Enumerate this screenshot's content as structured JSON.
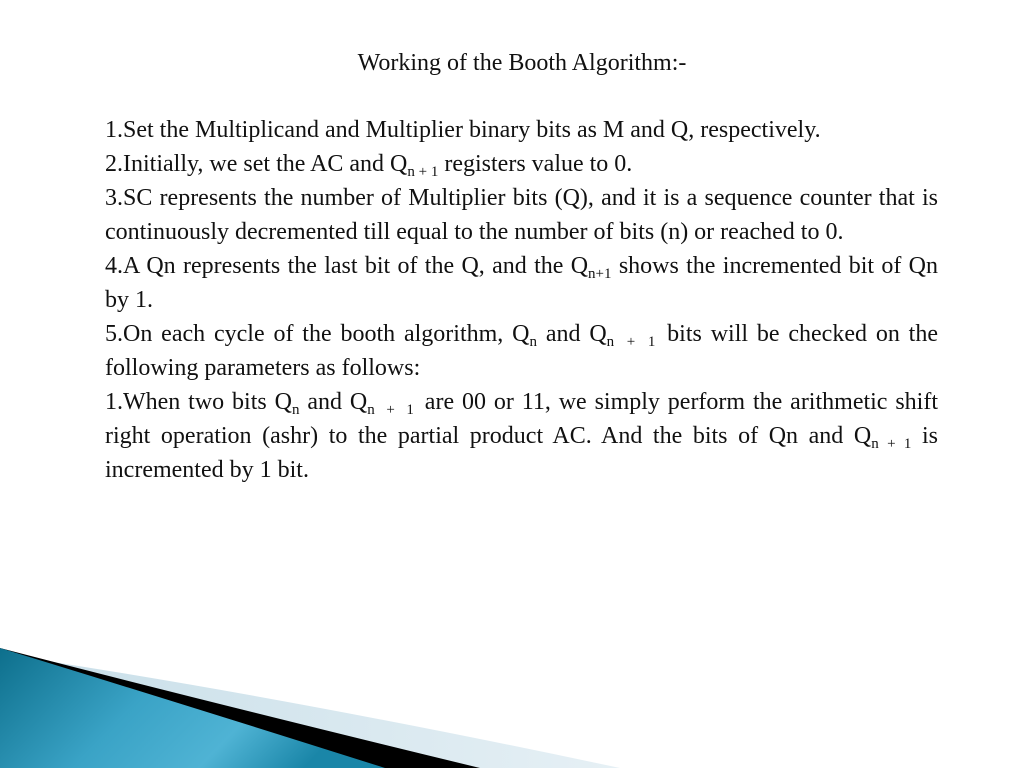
{
  "slide": {
    "title": "Working of the Booth Algorithm:-",
    "paragraphs": [
      {
        "id": "p1",
        "parts": [
          "1.Set the Multiplicand and Multiplier binary bits as M and Q, respectively."
        ]
      },
      {
        "id": "p2",
        "pre": "2.Initially, we set the AC and Q",
        "sub": "n + 1",
        "post": " registers value to 0."
      },
      {
        "id": "p3",
        "parts": [
          "3.SC represents the number of Multiplier bits (Q), and it is a sequence counter that is continuously decremented till equal to the number of bits (n) or reached to 0."
        ]
      },
      {
        "id": "p4",
        "pre": "4.A Qn represents the last bit of the Q, and the Q",
        "sub": "n+1",
        "post": " shows the incremented bit of Qn by 1."
      },
      {
        "id": "p5",
        "t1": "5.On each cycle of the booth algorithm, Q",
        "s1": "n",
        "t2": " and Q",
        "s2": "n + 1",
        "t3": " bits will be checked on the following parameters as follows:"
      },
      {
        "id": "p6",
        "t1": "1.When two bits Q",
        "s1": "n",
        "t2": " and Q",
        "s2": "n + 1",
        "t3": " are 00 or 11, we simply perform the arithmetic shift right operation (ashr) to the partial product AC. And the bits of Qn and Q",
        "s3": "n + 1",
        "t4": " is incremented by 1 bit."
      }
    ]
  },
  "decor": {
    "wave_colors": {
      "teal_dark": "#0d6f8c",
      "teal_light": "#4fb3d4",
      "black_band": "#000000",
      "pale_band": "#d6e8f0"
    }
  }
}
